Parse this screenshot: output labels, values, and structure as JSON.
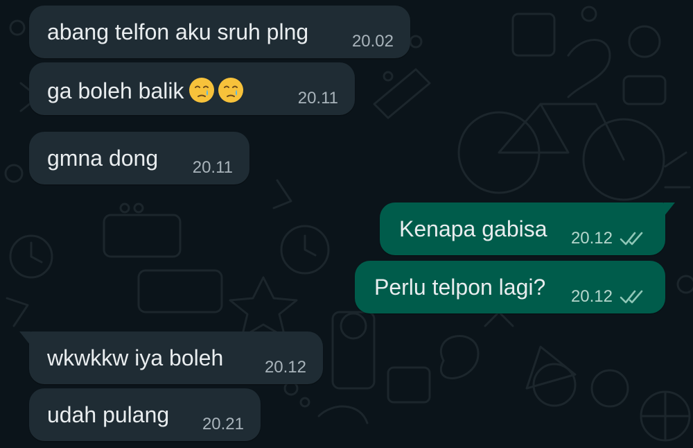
{
  "colors": {
    "background": "#0b141a",
    "incoming_bubble": "#1f2c34",
    "outgoing_bubble": "#005c4b",
    "text": "#e9edef",
    "read_ticks": "#8fc7b7"
  },
  "messages": [
    {
      "direction": "incoming",
      "text": "abang telfon aku sruh plng",
      "time": "20.02"
    },
    {
      "direction": "incoming",
      "text": "ga boleh balik",
      "emoji": [
        "crying-face",
        "crying-face"
      ],
      "time": "20.11"
    },
    {
      "direction": "incoming",
      "text": "gmna dong",
      "time": "20.11"
    },
    {
      "direction": "outgoing",
      "text": "Kenapa gabisa",
      "time": "20.12",
      "status": "read-double-check"
    },
    {
      "direction": "outgoing",
      "text": "Perlu telpon lagi?",
      "time": "20.12",
      "status": "read-double-check"
    },
    {
      "direction": "incoming",
      "text": "wkwkkw iya boleh",
      "time": "20.12"
    },
    {
      "direction": "incoming",
      "text": "udah pulang",
      "time": "20.21"
    }
  ]
}
